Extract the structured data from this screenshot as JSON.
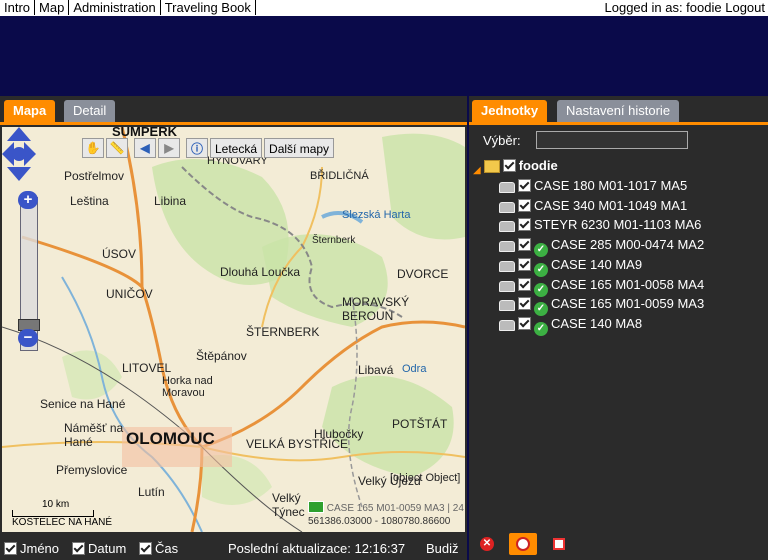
{
  "topnav": {
    "items": [
      "Intro",
      "Map",
      "Administration",
      "Traveling Book"
    ],
    "logged_in_text": "Logged in as: foodie",
    "logout_label": "Logout"
  },
  "left_tabs": [
    "Mapa",
    "Detail"
  ],
  "right_tabs": [
    "Jednotky",
    "Nastavení historie"
  ],
  "map": {
    "toolbar_text_leteca": "Letecká",
    "toolbar_more_maps": "Další mapy",
    "labels": [
      "ŠUMPERK",
      "HYNOVARY",
      "BŘIDLIČNÁ",
      "Postřelmov",
      "Leština",
      "Libina",
      "Slezská Harta",
      "Šternberk",
      "ÚSOV",
      "Dlouhá Loučka",
      "UNIČOV",
      "LITOVEL",
      "Horka nad Moravou",
      "Štěpánov",
      "Senice na Hané",
      "Náměšť na Hané",
      "OLOMOUC",
      "VELKÁ BYSTŘICE",
      "Hlubočky",
      "Přemyslovice",
      "Lutín",
      "MORAVSKÝ BEROUN",
      "DVORCE",
      "POTŠTÁT",
      "Velký Újezd",
      "Velký Týnec",
      "Libavá",
      "ŠTERNBERK",
      "Odra"
    ],
    "vehicle_label": "CASE 165 M01-0059 MA3 | 24",
    "object_label": "[object Object]",
    "coords": "561386.03000 - 1080780.86600",
    "scale_label": "10 km",
    "scale_town": "KOSTELEC NA HANÉ"
  },
  "map_footer": {
    "name_label": "Jméno",
    "date_label": "Datum",
    "time_label": "Čas",
    "last_update_text": "Poslední aktualizace: 12:16:37",
    "budiz_label": "Budiž"
  },
  "filter": {
    "label": "Výběr:",
    "value": ""
  },
  "tree": {
    "root_label": "foodie",
    "items": [
      {
        "label": "CASE 180 M01-1017 MA5",
        "status": "none"
      },
      {
        "label": "CASE 340 M01-1049 MA1",
        "status": "none"
      },
      {
        "label": "STEYR 6230 M01-1103 MA6",
        "status": "none"
      },
      {
        "label": "CASE 285 M00-0474 MA2",
        "status": "ok"
      },
      {
        "label": "CASE 140 MA9",
        "status": "ok"
      },
      {
        "label": "CASE 165 M01-0058 MA4",
        "status": "ok"
      },
      {
        "label": "CASE 165 M01-0059 MA3",
        "status": "ok"
      },
      {
        "label": "CASE 140 MA8",
        "status": "ok"
      }
    ]
  },
  "colors": {
    "accent": "#ff8c00",
    "background": "#0a0a4a",
    "panel": "#2b2b2b"
  }
}
